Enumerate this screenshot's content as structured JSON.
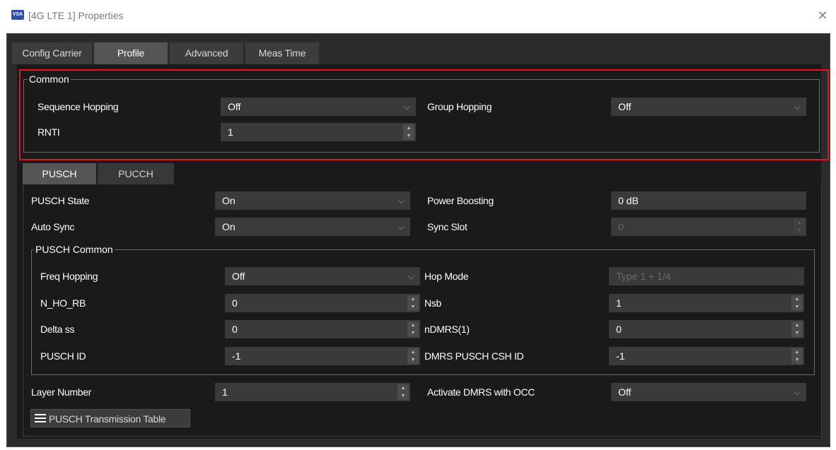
{
  "window": {
    "app_icon_text": "VSA",
    "title": "[4G LTE 1] Properties",
    "close_glyph": "✕"
  },
  "main_tabs": [
    {
      "label": "Config Carrier",
      "active": false
    },
    {
      "label": "Profile",
      "active": true
    },
    {
      "label": "Advanced",
      "active": false
    },
    {
      "label": "Meas Time",
      "active": false
    }
  ],
  "common": {
    "group_label": "Common",
    "sequence_hopping": {
      "label": "Sequence Hopping",
      "value": "Off"
    },
    "group_hopping": {
      "label": "Group Hopping",
      "value": "Off"
    },
    "rnti": {
      "label": "RNTI",
      "value": "1"
    }
  },
  "sub_tabs": [
    {
      "label": "PUSCH",
      "active": true
    },
    {
      "label": "PUCCH",
      "active": false
    }
  ],
  "pusch": {
    "state": {
      "label": "PUSCH State",
      "value": "On"
    },
    "power_boosting": {
      "label": "Power Boosting",
      "value": "0 dB"
    },
    "auto_sync": {
      "label": "Auto Sync",
      "value": "On"
    },
    "sync_slot": {
      "label": "Sync Slot",
      "value": "0"
    },
    "common_group_label": "PUSCH Common",
    "freq_hopping": {
      "label": "Freq Hopping",
      "value": "Off"
    },
    "hop_mode": {
      "label": "Hop Mode",
      "value": "Type 1 + 1/4"
    },
    "n_ho_rb": {
      "label": "N_HO_RB",
      "value": "0"
    },
    "nsb": {
      "label": "Nsb",
      "value": "1"
    },
    "delta_ss": {
      "label": "Delta ss",
      "value": "0"
    },
    "ndmrs1": {
      "label": "nDMRS(1)",
      "value": "0"
    },
    "pusch_id": {
      "label": "PUSCH ID",
      "value": "-1"
    },
    "dmrs_pusch_csh_id": {
      "label": "DMRS PUSCH CSH ID",
      "value": "-1"
    },
    "layer_number": {
      "label": "Layer Number",
      "value": "1"
    },
    "activate_dmrs_occ": {
      "label": "Activate DMRS with OCC",
      "value": "Off"
    },
    "transmission_table_button": "PUSCH Transmission Table"
  },
  "icons": {
    "dropdown": "⌵",
    "spin_up": "▲",
    "spin_down": "▼"
  },
  "colors": {
    "dialog_bg": "#2b2b2b",
    "panel_bg": "#1a1a1a",
    "field_bg": "#3a3a3a",
    "highlight": "#e0161c",
    "app_icon": "#2d4fa8"
  }
}
